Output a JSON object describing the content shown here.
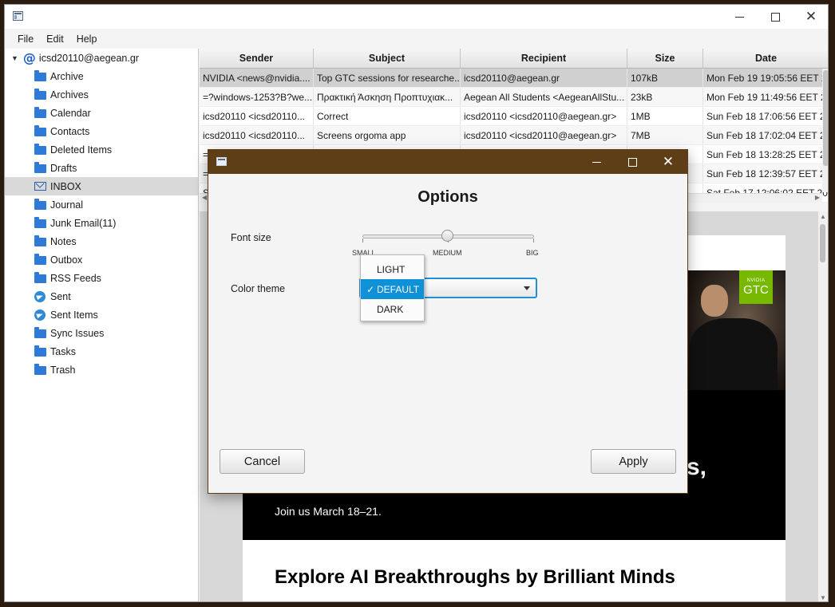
{
  "menu": [
    "File",
    "Edit",
    "Help"
  ],
  "account": "icsd20110@aegean.gr",
  "folders": [
    {
      "label": "Archive",
      "icon": "folder"
    },
    {
      "label": "Archives",
      "icon": "folder"
    },
    {
      "label": "Calendar",
      "icon": "folder"
    },
    {
      "label": "Contacts",
      "icon": "folder"
    },
    {
      "label": "Deleted Items",
      "icon": "folder"
    },
    {
      "label": "Drafts",
      "icon": "folder"
    },
    {
      "label": "INBOX",
      "icon": "inbox",
      "selected": true
    },
    {
      "label": "Journal",
      "icon": "folder"
    },
    {
      "label": "Junk Email(11)",
      "icon": "folder"
    },
    {
      "label": "Notes",
      "icon": "folder"
    },
    {
      "label": "Outbox",
      "icon": "folder"
    },
    {
      "label": "RSS Feeds",
      "icon": "folder"
    },
    {
      "label": "Sent",
      "icon": "send"
    },
    {
      "label": "Sent Items",
      "icon": "send"
    },
    {
      "label": "Sync Issues",
      "icon": "folder"
    },
    {
      "label": "Tasks",
      "icon": "folder"
    },
    {
      "label": "Trash",
      "icon": "folder"
    }
  ],
  "table": {
    "columns": [
      "Sender",
      "Subject",
      "Recipient",
      "Size",
      "Date"
    ],
    "rows": [
      {
        "sender": "NVIDIA <news@nvidia....",
        "subject": "Top GTC sessions for researche...",
        "recipient": "icsd20110@aegean.gr",
        "size": "107kB",
        "date": "Mon Feb 19 19:05:56 EET 2..."
      },
      {
        "sender": "=?windows-1253?B?we...",
        "subject": "Πρακτική Άσκηση Προπτυχιακ...",
        "recipient": "Aegean All Students <AegeanAllStu...",
        "size": "23kB",
        "date": "Mon Feb 19 11:49:56 EET 2..."
      },
      {
        "sender": "icsd20110 <icsd20110...",
        "subject": "Correct",
        "recipient": "icsd20110 <icsd20110@aegean.gr>",
        "size": "1MB",
        "date": "Sun Feb 18 17:06:56 EET 2..."
      },
      {
        "sender": "icsd20110 <icsd20110...",
        "subject": "Screens orgoma app",
        "recipient": "icsd20110 <icsd20110@aegean.gr>",
        "size": "7MB",
        "date": "Sun Feb 18 17:02:04 EET 2..."
      },
      {
        "sender": "=",
        "subject": "",
        "recipient": "",
        "size": "",
        "date": "Sun Feb 18 13:28:25 EET 2..."
      },
      {
        "sender": "=",
        "subject": "",
        "recipient": "",
        "size": "",
        "date": "Sun Feb 18 12:39:57 EET 2..."
      },
      {
        "sender": "Sy",
        "subject": "",
        "recipient": "",
        "size": "",
        "date": "Sat Feb 17 12:06:02 EET 20..."
      }
    ]
  },
  "email": {
    "badge_small": "NVIDIA",
    "badge": "GTC",
    "hero_fragment": "s,",
    "join": "Join us March 18–21.",
    "heading": "Explore AI Breakthroughs by Brilliant Minds"
  },
  "dialog": {
    "title": "Options",
    "font_size_label": "Font size",
    "slider_labels": [
      "SMALL",
      "MEDIUM",
      "BIG"
    ],
    "slider_value": "MEDIUM",
    "color_theme_label": "Color theme",
    "theme_options": [
      "LIGHT",
      "DEFAULT",
      "DARK"
    ],
    "theme_selected": "DEFAULT",
    "check_glyph": "✓",
    "cancel": "Cancel",
    "apply": "Apply",
    "accent": "#0e91d6",
    "title_bar_color": "#5d3e16"
  },
  "icons": {
    "close": "✕"
  }
}
